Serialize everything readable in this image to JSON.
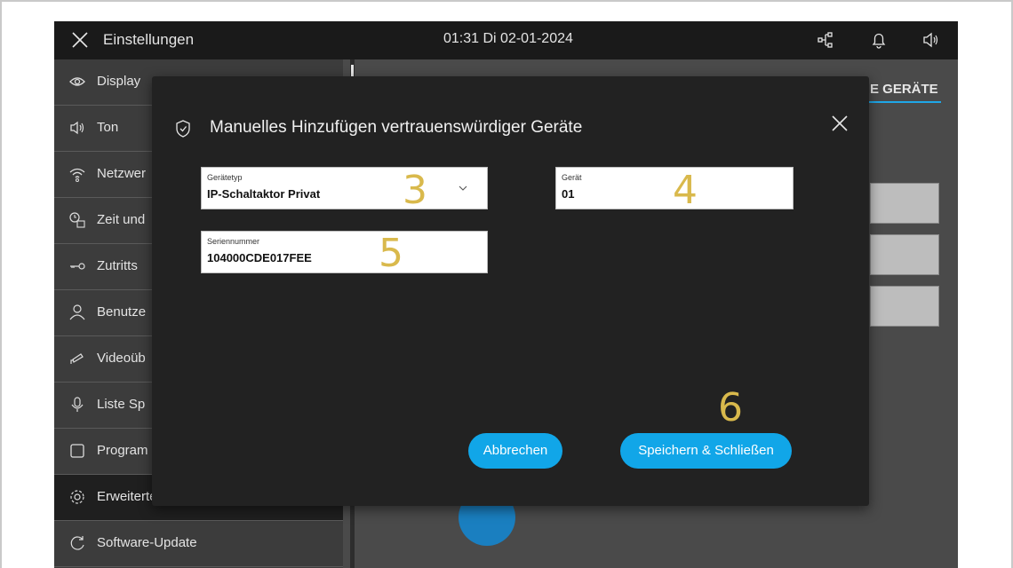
{
  "topbar": {
    "title": "Einstellungen",
    "datetime": "01:31  Di 02-01-2024"
  },
  "sidebar": {
    "items": [
      {
        "label": "Display",
        "icon": "eye-icon"
      },
      {
        "label": "Ton",
        "icon": "speaker-icon"
      },
      {
        "label": "Netzwer",
        "icon": "wifi-icon"
      },
      {
        "label": "Zeit und",
        "icon": "clock-calendar-icon"
      },
      {
        "label": "Zutritts",
        "icon": "key-icon"
      },
      {
        "label": "Benutze",
        "icon": "user-icon"
      },
      {
        "label": "Videoüb",
        "icon": "camera-icon"
      },
      {
        "label": "Liste Sp",
        "icon": "microphone-icon"
      },
      {
        "label": "Program",
        "icon": "square-icon"
      },
      {
        "label": "Erweiterte Einstellungen",
        "icon": "gear-icon"
      },
      {
        "label": "Software-Update",
        "icon": "refresh-icon"
      }
    ]
  },
  "background": {
    "tab_label": "E GERÄTE",
    "accent_color": "#1fa7e8"
  },
  "dialog": {
    "title": "Manuelles Hinzufügen vertrauenswürdiger Geräte",
    "device_type": {
      "label": "Gerätetyp",
      "value": "IP-Schaltaktor Privat"
    },
    "device": {
      "label": "Gerät",
      "value": "01"
    },
    "serial": {
      "label": "Seriennummer",
      "value": "104000CDE017FEE"
    },
    "cancel_label": "Abbrechen",
    "save_label": "Speichern & Schließen",
    "button_color": "#11a6e8"
  },
  "annotations": {
    "n3": "3",
    "n4": "4",
    "n5": "5",
    "n6": "6"
  }
}
